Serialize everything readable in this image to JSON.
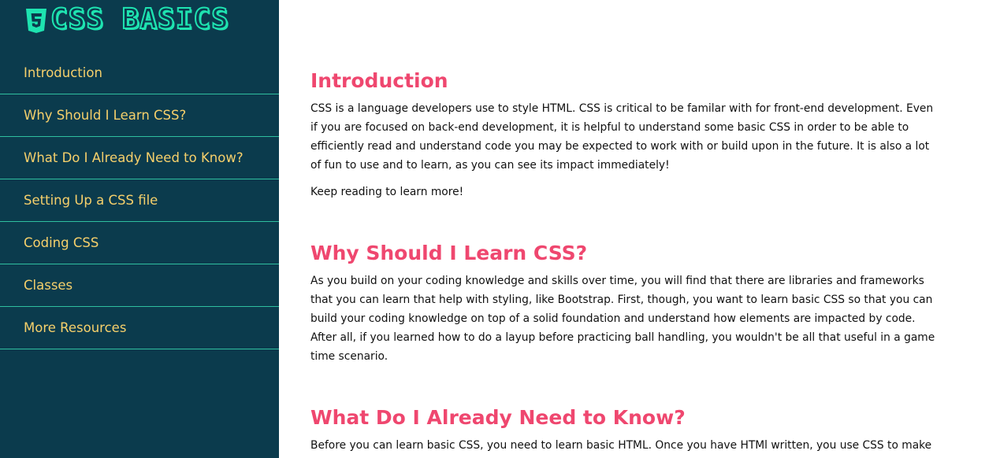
{
  "site": {
    "logo_text": "CSS BASICS",
    "logo_icon": "css3-icon"
  },
  "nav": {
    "items": [
      {
        "label": "Introduction"
      },
      {
        "label": "Why Should I Learn CSS?"
      },
      {
        "label": "What Do I Already Need to Know?"
      },
      {
        "label": "Setting Up a CSS file"
      },
      {
        "label": "Coding CSS"
      },
      {
        "label": "Classes"
      },
      {
        "label": "More Resources"
      }
    ]
  },
  "sections": [
    {
      "title": "Introduction",
      "paragraphs": [
        "CSS is a language developers use to style HTML. CSS is critical to be familar with for front-end development. Even if you are focused on back-end development, it is helpful to understand some basic CSS in order to be able to efficiently read and understand code you may be expected to work with or build upon in the future. It is also a lot of fun to use and to learn, as you can see its impact immediately!",
        "Keep reading to learn more!"
      ]
    },
    {
      "title": "Why Should I Learn CSS?",
      "paragraphs": [
        "As you build on your coding knowledge and skills over time, you will find that there are libraries and frameworks that you can learn that help with styling, like Bootstrap. First, though, you want to learn basic CSS so that you can build your coding knowledge on top of a solid foundation and understand how elements are impacted by code. After all, if you learned how to do a layup before practicing ball handling, you wouldn't be all that useful in a game time scenario."
      ]
    },
    {
      "title": "What Do I Already Need to Know?",
      "paragraphs": [
        "Before you can learn basic CSS, you need to learn basic HTML. Once you have HTMl written, you use CSS to make"
      ]
    }
  ],
  "colors": {
    "sidebar_bg": "#0b3b4d",
    "nav_text": "#f6d06b",
    "nav_divider": "#2fbfa0",
    "logo_accent": "#1ee3b0",
    "heading": "#ef476f",
    "body_text": "#111111"
  }
}
